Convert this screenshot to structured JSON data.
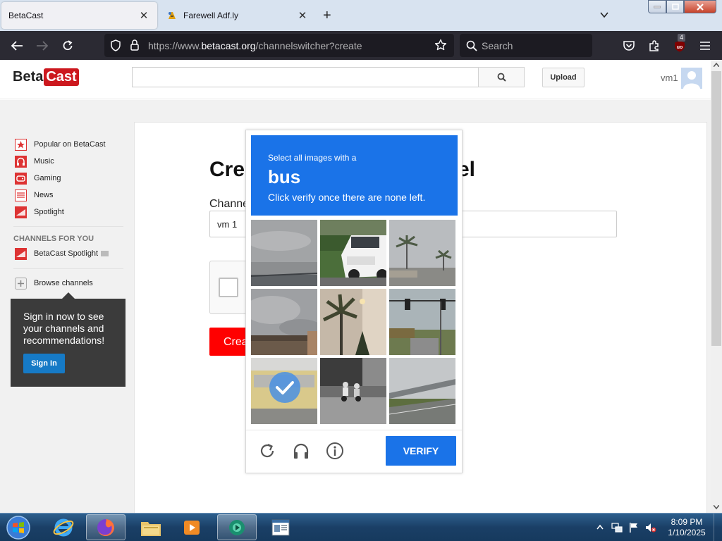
{
  "browser": {
    "tabs": [
      {
        "label": "BetaCast",
        "active": true
      },
      {
        "label": "Farewell Adf.ly",
        "active": false
      }
    ],
    "url": {
      "prefix": "https://www.",
      "host": "betacast.org",
      "path": "/channelswitcher?create"
    },
    "search_placeholder": "Search",
    "ublock_count": "4"
  },
  "site": {
    "logo_beta": "Beta",
    "logo_cast": "Cast",
    "upload_label": "Upload",
    "username": "vm1",
    "guide": {
      "items": [
        {
          "label": "Popular on BetaCast",
          "icon": "star-icon"
        },
        {
          "label": "Music",
          "icon": "headphones-icon"
        },
        {
          "label": "Gaming",
          "icon": "gamepad-icon"
        },
        {
          "label": "News",
          "icon": "newspaper-icon"
        },
        {
          "label": "Spotlight",
          "icon": "spotlight-icon"
        }
      ],
      "channels_heading": "CHANNELS FOR YOU",
      "channels": [
        {
          "label": "BetaCast Spotlight"
        }
      ],
      "browse_label": "Browse channels"
    },
    "signin_prompt": {
      "text": "Sign in now to see your channels and recommendations!",
      "button": "Sign In"
    },
    "create": {
      "title_left": "Cre",
      "title_right": "el",
      "channel_label": "Channe",
      "channel_value": "vm 1",
      "button_label": "Crea"
    }
  },
  "captcha": {
    "prompt": "Select all images with a",
    "object": "bus",
    "instruction": "Click verify once there are none left.",
    "verify_label": "VERIFY",
    "tiles": [
      {
        "name": "cloudy-sky",
        "selected": false
      },
      {
        "name": "white-suv",
        "selected": false
      },
      {
        "name": "palm-trees",
        "selected": false
      },
      {
        "name": "cloudy-rooftop",
        "selected": false
      },
      {
        "name": "palm-tree-closeup",
        "selected": false
      },
      {
        "name": "traffic-lights",
        "selected": false
      },
      {
        "name": "school-bus",
        "selected": true
      },
      {
        "name": "motorcyclists",
        "selected": false
      },
      {
        "name": "overpass",
        "selected": false
      }
    ]
  },
  "taskbar": {
    "time": "8:09 PM",
    "date": "1/10/2025"
  }
}
